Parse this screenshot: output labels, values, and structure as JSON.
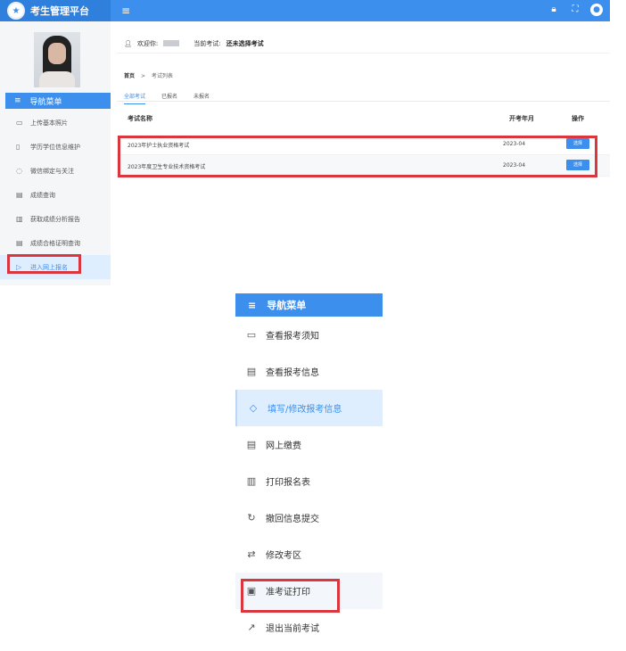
{
  "app": {
    "title": "考生管理平台",
    "logo_icon": "emblem-icon"
  },
  "topbar": {
    "menu_icon": "≡",
    "icons": [
      "lock-icon",
      "fullscreen-icon",
      "user-icon"
    ]
  },
  "sidebar": {
    "header": "导航菜单",
    "items": [
      {
        "label": "上传基本照片",
        "icon": "▭"
      },
      {
        "label": "学历学位信息维护",
        "icon": "▯"
      },
      {
        "label": "微信绑定与关注",
        "icon": "◌"
      },
      {
        "label": "成绩查询",
        "icon": "▤"
      },
      {
        "label": "获取成绩分析报告",
        "icon": "▥"
      },
      {
        "label": "成绩合格证明查询",
        "icon": "▤"
      },
      {
        "label": "进入网上报名",
        "icon": "▷"
      }
    ]
  },
  "welcome": {
    "prefix": "欢迎你:",
    "current_label": "当前考试:",
    "current_value": "还未选择考试"
  },
  "breadcrumb": {
    "home": "首页",
    "sep": ">",
    "current": "考试列表"
  },
  "tabs": [
    "全部考试",
    "已报名",
    "未报名"
  ],
  "table": {
    "headers": [
      "考试名称",
      "开考年月",
      "操作"
    ],
    "rows": [
      {
        "name": "2023年护士执业资格考试",
        "date": "2023-04",
        "action": "选择"
      },
      {
        "name": "2023年度卫生专业技术资格考试",
        "date": "2023-04",
        "action": "选择"
      }
    ]
  },
  "menu": {
    "header": "导航菜单",
    "items": [
      {
        "label": "查看报考须知",
        "icon": "▭"
      },
      {
        "label": "查看报考信息",
        "icon": "▤"
      },
      {
        "label": "填写/修改报考信息",
        "icon": "◇"
      },
      {
        "label": "网上缴费",
        "icon": "▤"
      },
      {
        "label": "打印报名表",
        "icon": "▥"
      },
      {
        "label": "撤回信息提交",
        "icon": "↻"
      },
      {
        "label": "修改考区",
        "icon": "⇄"
      },
      {
        "label": "准考证打印",
        "icon": "▣"
      },
      {
        "label": "退出当前考试",
        "icon": "↗"
      }
    ]
  },
  "colors": {
    "accent": "#3c8fec",
    "highlight": "#d9363e",
    "active_bg": "#dfeeff"
  }
}
